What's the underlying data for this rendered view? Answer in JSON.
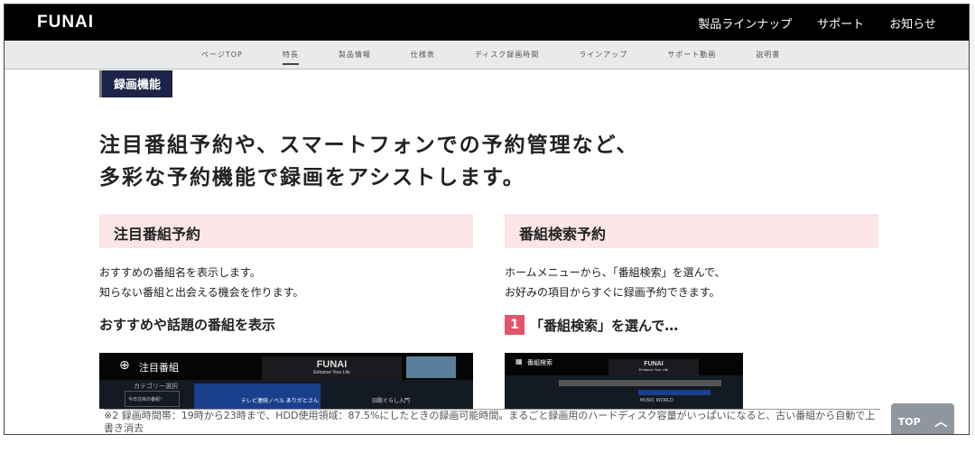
{
  "header": {
    "logo": "FUNAI",
    "nav": [
      "製品ラインナップ",
      "サポート",
      "お知らせ"
    ]
  },
  "subnav": {
    "items": [
      "ページTOP",
      "特長",
      "製品情報",
      "仕様表",
      "ディスク録画時間",
      "ラインアップ",
      "サポート動画",
      "説明書"
    ],
    "active": 1
  },
  "section_tag": "録画機能",
  "headline": [
    "注目番組予約や、スマートフォンでの予約管理など、",
    "多彩な予約機能で録画をアシストします。"
  ],
  "left": {
    "title": "注目番組予約",
    "desc": [
      "おすすめの番組名を表示します。",
      "知らない番組と出会える機会を作ります。"
    ],
    "subtitle": "おすすめや話題の番組を表示",
    "screen": {
      "title": "注目番組",
      "category": "カテゴリー選択",
      "today": "今日注目の番組！",
      "card1": "テレビ連続ノベル ありがとさん",
      "card2": "旧歌ぐらし入門",
      "brand": "FUNAI",
      "tagline": "Enhance Your Life"
    }
  },
  "right": {
    "title": "番組検索予約",
    "desc": [
      "ホームメニューから、「番組検索」を選んで、",
      "お好みの項目からすぐに録画予約できます。"
    ],
    "step_number": "1",
    "step_text": "「番組検索」を選んで…",
    "screen": {
      "title": "番組検索",
      "brand": "FUNAI",
      "tagline": "Enhance Your Life",
      "item": "MUSIC WORLD"
    }
  },
  "footnote": "※2 録画時間帯：19時から23時まで、HDD使用領域：87.5%にしたときの録画可能時間。まるごと録画用のハードディスク容量がいっぱいになると、古い番組から自動で上書き消去",
  "top_button": {
    "label": "TOP",
    "icon": "chevron-up-icon"
  }
}
